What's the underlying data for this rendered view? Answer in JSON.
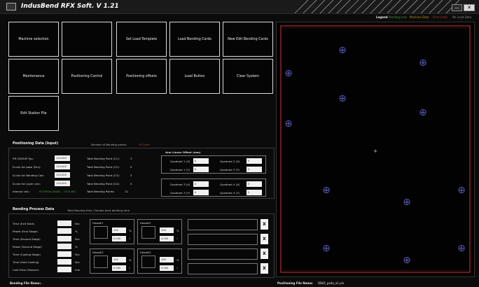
{
  "title_bar": {
    "app_title": "IndusBend RFX Soft. V 1.21"
  },
  "legend": {
    "label": "Legend",
    "items": [
      {
        "text": "Pending Lens",
        "color": "#3f9b3f"
      },
      {
        "text": "Machine Data",
        "color": "#c98a2a"
      },
      {
        "text": "Error Limit",
        "color": "#c43030"
      },
      {
        "text": "No Load Data",
        "color": "#888888"
      }
    ]
  },
  "menu_buttons": [
    {
      "label": "Machine selection"
    },
    {
      "label": ""
    },
    {
      "label": "Set Load Template"
    },
    {
      "label": "Load Bending Cards"
    },
    {
      "label": "New Edit Bending Cards"
    },
    {
      "label": "Maintenance"
    },
    {
      "label": "Positioning Control"
    },
    {
      "label": "Positioning offsets"
    },
    {
      "label": "Load Button"
    },
    {
      "label": "Clear System"
    },
    {
      "label": "Edit Station File"
    }
  ],
  "positioning": {
    "title": "Positioning Data (Input)",
    "subtitle": "Number of Bending points:",
    "subtitle_value": "70.7mm",
    "rows": [
      {
        "label": "P.R.F.DRUM Typ:",
        "value": "120.000"
      },
      {
        "label": "D.calc for base (Drv):",
        "value": "120.000"
      },
      {
        "label": "D.calc for Bending Calc:",
        "value": "120.000"
      },
      {
        "label": "D.calc for Layer calc:",
        "value": "120.000"
      }
    ],
    "interval_label": "Interval calc.:",
    "interval_value": "INTERVAL(BASE) - TOOLING",
    "bend_points": [
      {
        "label": "Total Bending Point (C1):",
        "value": "3"
      },
      {
        "label": "Total Bending Point (C2):",
        "value": "0"
      },
      {
        "label": "Total Bending Point (C3):",
        "value": "3"
      },
      {
        "label": "Total Bending Point (C4):",
        "value": "0"
      },
      {
        "label": "Total Bending Points:",
        "value": "12"
      }
    ],
    "offsets_title": "Arm Linear Offset (mm)",
    "offsets": [
      {
        "label": "Quadrant 1 (X)",
        "value": "0"
      },
      {
        "label": "Quadrant 1 (Y)",
        "value": "0"
      },
      {
        "label": "Quadrant 2 (X)",
        "value": "0"
      },
      {
        "label": "Quadrant 2 (Y)",
        "value": "0"
      },
      {
        "label": "Quadrant 3 (X)",
        "value": "0"
      },
      {
        "label": "Quadrant 3 (Y)",
        "value": "0"
      },
      {
        "label": "Quadrant 4 (X)",
        "value": "0"
      },
      {
        "label": "Quadrant 4 (Y)",
        "value": "0"
      }
    ]
  },
  "bending": {
    "title": "Bending Process Data",
    "subtitle": "Total Bending time / Double bent bending time",
    "params": [
      {
        "label": "Time (Exit Start)",
        "unit": "Sec"
      },
      {
        "label": "Power (First Stage)",
        "unit": "%"
      },
      {
        "label": "Time (Second Stage)",
        "unit": "Sec"
      },
      {
        "label": "Power (Second Stage)",
        "unit": "%"
      },
      {
        "label": "Time (Cooling Stage)",
        "unit": "Sec"
      },
      {
        "label": "Time (Hold Cooling)",
        "unit": "Sec"
      },
      {
        "label": "Cold Fresh Distance",
        "unit": "mm"
      }
    ],
    "heads": [
      {
        "name": "Head#1",
        "val1": "100",
        "val2": "0.000",
        "u1": "%",
        "u2": "°"
      },
      {
        "name": "Head#2",
        "val1": "100",
        "val2": "0.000",
        "u1": "%",
        "u2": "°"
      },
      {
        "name": "Head#3",
        "val1": "100",
        "val2": "0.000",
        "u1": "%",
        "u2": "°"
      },
      {
        "name": "Head#4",
        "val1": "100",
        "val2": "0.000",
        "u1": "%",
        "u2": "°"
      }
    ],
    "message_rows": [
      "",
      "",
      "",
      ""
    ],
    "x_label": "X"
  },
  "status": {
    "bending_file_label": "Bending File Name:",
    "bending_file_value": "...",
    "positioning_file_label": "Positioning File Name:",
    "positioning_file_value": "DBLR_pada_a1.pin"
  },
  "canvas": {
    "crosshair_label": "+",
    "pin_glyph": "⊕",
    "frame_color": "#b52a2a",
    "pin_color": "#5a5ab8"
  }
}
